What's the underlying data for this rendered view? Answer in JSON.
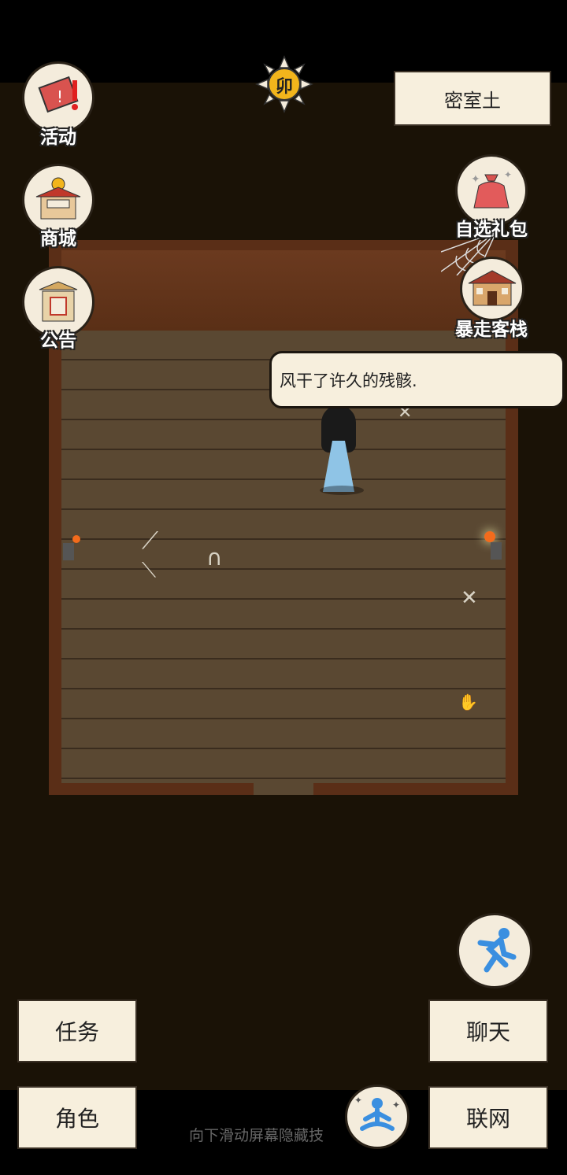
{
  "hud": {
    "time_badge": "卯",
    "location_name": "密室土"
  },
  "left_menu": [
    {
      "label": "活动",
      "icon": "event-scroll-icon"
    },
    {
      "label": "商城",
      "icon": "shop-building-icon"
    },
    {
      "label": "公告",
      "icon": "notice-board-icon"
    }
  ],
  "right_menu": [
    {
      "label": "自选礼包",
      "icon": "gift-bag-icon"
    },
    {
      "label": "暴走客栈",
      "icon": "inn-building-icon"
    }
  ],
  "dialog": {
    "text": "风干了许久的残骸."
  },
  "bottom_buttons": {
    "task": "任务",
    "character": "角色",
    "chat": "聊天",
    "network": "联网"
  },
  "hint_text": "向下滑动屏幕隐藏技",
  "colors": {
    "panel_bg": "#f7efdd",
    "floor": "#5a4832",
    "wall": "#5a2e17",
    "accent_gold": "#f2b51c",
    "sprint_blue": "#3a8fe0"
  }
}
